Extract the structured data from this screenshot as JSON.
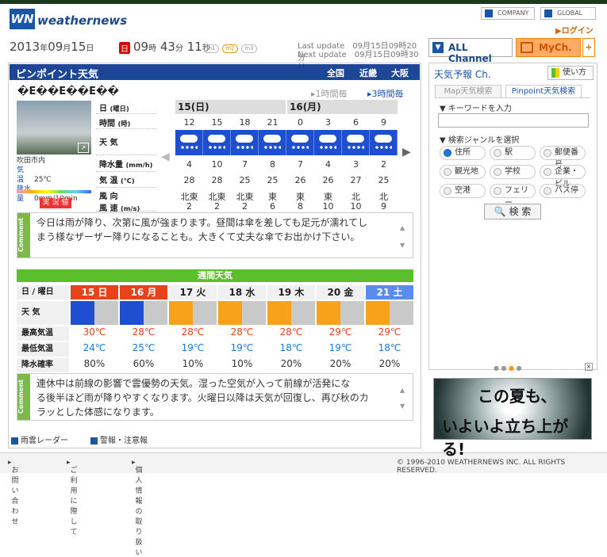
{
  "brand": {
    "name": "weathernews",
    "login": "ログイン",
    "company": "COMPANY",
    "global": "GLOBAL"
  },
  "datetime": {
    "year": "2013",
    "year_u": "年",
    "month": "09",
    "month_u": "月",
    "day": "15",
    "day_u": "日",
    "dow": "日",
    "hour": "09",
    "hour_u": "時",
    "min": "43",
    "min_u": "分",
    "sec": "11",
    "sec_u": "秒",
    "pills": [
      "m1",
      "m2",
      "m3"
    ]
  },
  "update": {
    "last_label": "Last update",
    "last_value": "09月15日09時20分",
    "next_label": "Next update",
    "next_value": "09月15日09時30分"
  },
  "pinpoint": {
    "title": "ピンポイント天気",
    "regions": [
      "全国",
      "近畿",
      "大阪"
    ],
    "location": "�E��E��E��",
    "link_1h": "1時間毎",
    "link_3h": "3時間毎"
  },
  "station": {
    "name": "吹田市内",
    "temp_label": "気　温",
    "temp": "25℃",
    "rain_label": "降水量",
    "rain": "0mm/10min",
    "live_label": "実 況 値"
  },
  "hourly": {
    "row_labels": {
      "day": "日",
      "day_sub": "(曜日)",
      "time": "時間",
      "time_sub": "(時)",
      "weather": "天 気",
      "precip": "降水量",
      "precip_sub": "(mm/h)",
      "temp": "気 温",
      "temp_sub": "(℃)",
      "wind": "風 向",
      "wind2": "風 速",
      "wind_sub": "(m/s)"
    },
    "days": [
      "15(日)",
      "16(月)"
    ],
    "times": [
      "12",
      "15",
      "18",
      "21",
      "0",
      "3",
      "6",
      "9"
    ],
    "weather": [
      "rain-icon",
      "rain-icon",
      "rain-icon",
      "rain-icon",
      "rain-icon",
      "rain-icon",
      "rain-icon",
      "rain-icon"
    ],
    "precip": [
      "4",
      "10",
      "7",
      "8",
      "7",
      "4",
      "3",
      "2"
    ],
    "temps": [
      "28",
      "28",
      "25",
      "25",
      "26",
      "26",
      "27",
      "25"
    ],
    "wind_dir": [
      "北東",
      "北東",
      "北東",
      "東",
      "東",
      "東",
      "北",
      "北"
    ],
    "wind_speed": [
      "2",
      "2",
      "2",
      "6",
      "8",
      "10",
      "10",
      "9"
    ]
  },
  "comment1": {
    "tag": "Comment",
    "text_line1": "今日は雨が降り、次第に風が強まります。昼間は傘を差しても足元が濡れてし",
    "text_line2": "まう様なザーザー降りになることも。大きくて丈夫な傘でお出かけ下さい。"
  },
  "weekly": {
    "title": "週間天気",
    "row_labels": [
      "日 / 曜日",
      "天 気",
      "最高気温",
      "最低気温",
      "降水確率"
    ],
    "days": [
      {
        "label": "15 日",
        "color": "#e8421a"
      },
      {
        "label": "16 月",
        "color": "#e8421a"
      },
      {
        "label": "17 火",
        "color": "#f0f0f0"
      },
      {
        "label": "18 水",
        "color": "#f0f0f0"
      },
      {
        "label": "19 木",
        "color": "#f0f0f0"
      },
      {
        "label": "20 金",
        "color": "#f0f0f0"
      },
      {
        "label": "21 土",
        "color": "#5a8cf0"
      }
    ],
    "weather": [
      "rain-cloud-icon",
      "rain-sun-icon",
      "sun-cloud-icon",
      "sun-cloud-icon",
      "sun-cloud-icon",
      "sun-cloud-icon",
      "sun-cloud-icon"
    ],
    "high": [
      "30℃",
      "28℃",
      "28℃",
      "28℃",
      "28℃",
      "29℃",
      "29℃"
    ],
    "low": [
      "24℃",
      "25℃",
      "19℃",
      "19℃",
      "18℃",
      "19℃",
      "18℃"
    ],
    "pop": [
      "80%",
      "60%",
      "10%",
      "10%",
      "20%",
      "20%",
      "20%"
    ]
  },
  "comment2": {
    "tag": "Comment",
    "text_line1": "連休中は前線の影響で雲優勢の天気。湿った空気が入って前線が活発にな",
    "text_line2": "る後半ほど雨が降りやすくなります。火曜日以降は天気が回復し、再び秋のカ",
    "text_line3": "ラッとした体感になります。"
  },
  "bottom_links": [
    "雨雲レーダー",
    "警報・注意報"
  ],
  "footer": {
    "links": [
      "お問い合わせ",
      "ご利用に際して",
      "個人情報の取り扱い"
    ],
    "copyright": "© 1996-2010 WEATHERNEWS INC. ALL RIGHTS RESERVED."
  },
  "right": {
    "all_channel": "ALL Channel",
    "mych": "MyCh.",
    "plus": "+",
    "title": "天気予報 Ch.",
    "help": "使い方",
    "tabs": [
      "Map天気検索",
      "Pinpoint天気検索"
    ],
    "keyword_label": "キーワードを入力",
    "genre_label": "検索ジャンルを選択",
    "radios": [
      "住所",
      "駅",
      "郵便番号",
      "観光地",
      "学校",
      "企業・ビル",
      "空港",
      "フェリー",
      "バス停"
    ],
    "search": "検 索",
    "banner_line1": "この夏も、",
    "banner_line2": "いよいよ立ち上がる!"
  },
  "colors": {
    "brand_blue": "#1e4696",
    "green": "#5bbf2b",
    "orange": "#e8421a"
  }
}
